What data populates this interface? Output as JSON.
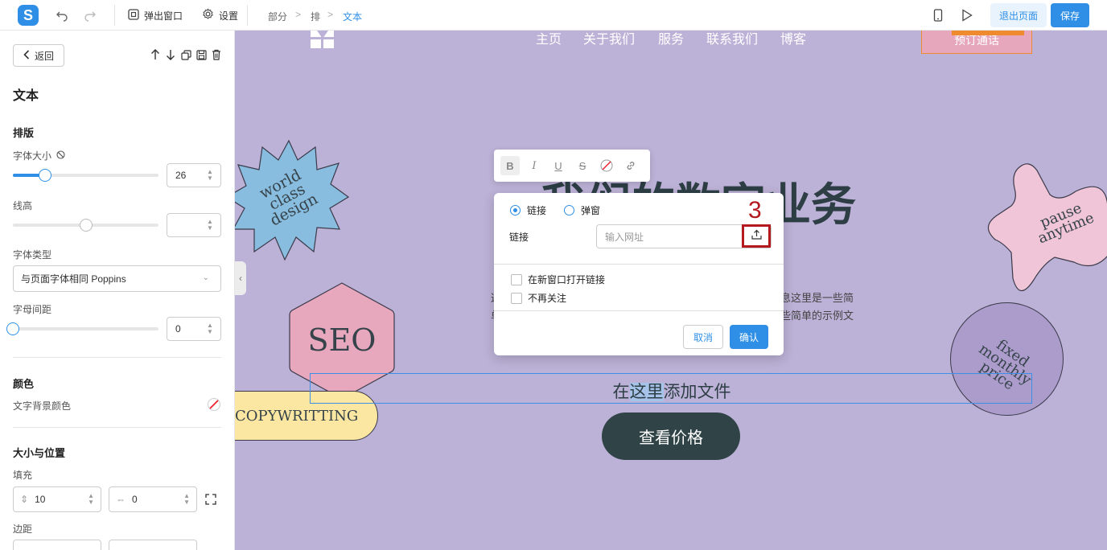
{
  "topbar": {
    "logo_letter": "S",
    "popup_label": "弹出窗口",
    "settings_label": "设置",
    "breadcrumb": [
      "部分",
      "排",
      "文本"
    ],
    "exit_label": "退出页面",
    "save_label": "保存"
  },
  "sidebar": {
    "back_label": "返回",
    "panel_title": "文本",
    "typography_section": "排版",
    "font_size_label": "字体大小",
    "font_size_value": "26",
    "font_size_fraction": 0.22,
    "line_height_label": "线高",
    "line_height_value": "",
    "line_height_fraction": 0.5,
    "font_type_label": "字体类型",
    "font_type_value": "与页面字体相同 Poppins",
    "letter_spacing_label": "字母间距",
    "letter_spacing_value": "0",
    "letter_spacing_fraction": 0,
    "color_section": "颜色",
    "text_bg_color_label": "文字背景颜色",
    "size_section": "大小与位置",
    "padding_label": "填充",
    "padding_vertical": "10",
    "padding_horizontal": "0",
    "margin_label": "边距"
  },
  "canvas": {
    "nav": [
      "主页",
      "关于我们",
      "服务",
      "联系我们",
      "博客"
    ],
    "nav_cta": "预订通话",
    "hero_title": "我们的数字业务",
    "body_line1_left": "这",
    "body_line1_right": "息这里是一些简",
    "body_line2_left": "单",
    "body_line2_right": "些简单的示例文",
    "selected_text_before": "在",
    "selected_text_highlight": "这里",
    "selected_text_after": "添加文件",
    "cta_button": "查看价格",
    "stickers": {
      "world": "world class design",
      "seo": "SEO",
      "copywriting": "COPYWRITTING",
      "pause": "pause anytime",
      "fixed": "fixed monthly price"
    },
    "colors": {
      "canvas_bg": "#bcb1d6",
      "accent": "#2f8fe6"
    }
  },
  "dialog": {
    "radio_link": "链接",
    "radio_popup": "弹窗",
    "link_label": "链接",
    "url_placeholder": "输入网址",
    "annotation_number": "3",
    "open_new_window": "在新窗口打开链接",
    "no_follow": "不再关注",
    "cancel_label": "取消",
    "confirm_label": "确认"
  }
}
